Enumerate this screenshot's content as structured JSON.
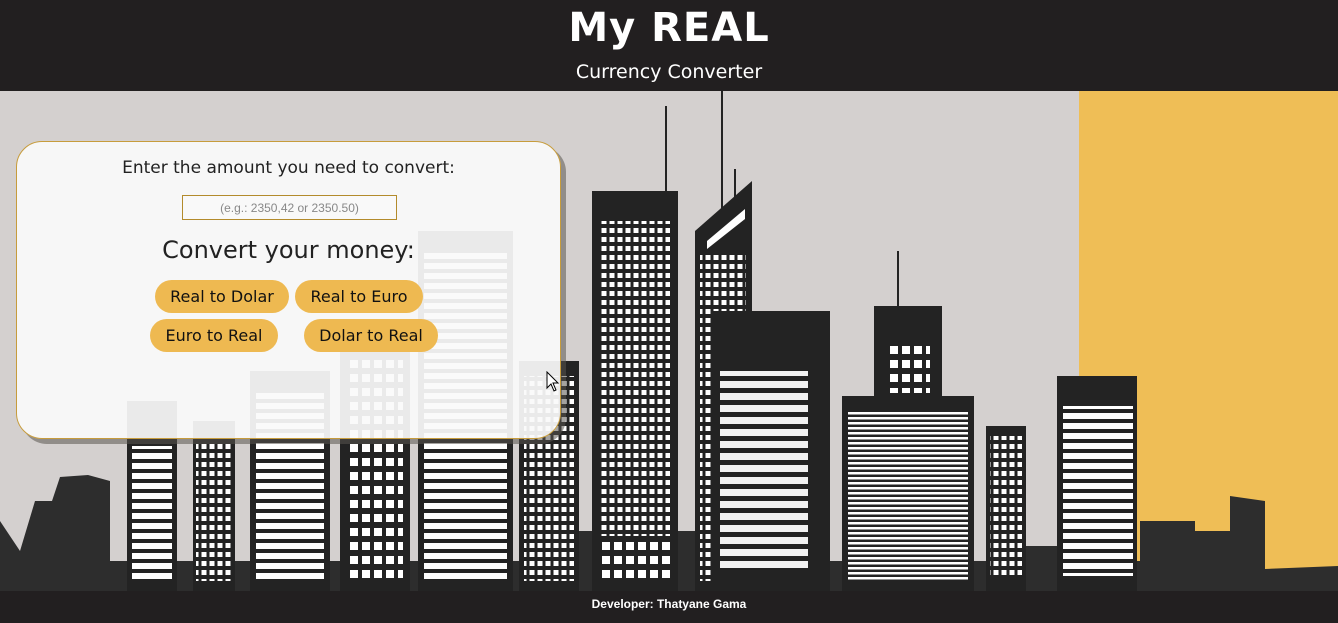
{
  "header": {
    "title": "My REAL",
    "subtitle": "Currency Converter"
  },
  "converter": {
    "prompt": "Enter the amount you need to convert:",
    "amount_value": "",
    "amount_placeholder": "(e.g.: 2350,42 or 2350.50)",
    "convert_title": "Convert your money:",
    "buttons": {
      "real_to_dolar": "Real to Dolar",
      "real_to_euro": "Real to Euro",
      "euro_to_real": "Euro to Real",
      "dolar_to_real": "Dolar to Real"
    },
    "button_color": "#eeb951"
  },
  "footer": {
    "credit": "Developer: Thatyane Gama"
  },
  "theme": {
    "header_bg": "#221f20",
    "sky": "#d4d0cf",
    "sun_panel": "#efbe56",
    "building_dark": "#232323"
  },
  "background_icon": "city-skyline-illustration",
  "cursor_icon": "mouse-pointer-icon"
}
